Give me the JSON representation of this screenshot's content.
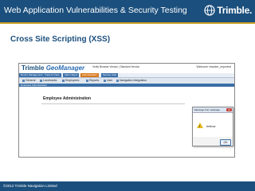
{
  "slide": {
    "header_title": "Web Application Vulnerabilities & Security Testing",
    "logo_text": "Trimble.",
    "title": "Cross Site Scripting (XSS)",
    "footer": "©2012 Trimble Navigation Limited",
    "colors": {
      "header": "#1b4f7d",
      "accent": "#c9a227",
      "title": "#1b4f7d"
    }
  },
  "app": {
    "logo_prefix": "Trimble",
    "logo_product": "GeoManager",
    "top_links": "Verify Browser Version | Standard Version",
    "welcome": "Welcome xtracker_imported",
    "tabs": [
      "Device Management",
      "Track & Trace",
      "Alarm Mgmt",
      "Administration",
      "Service Jobs"
    ],
    "active_tab": "Administration",
    "menu": [
      "General",
      "Landmarks",
      "Employees",
      "Reports",
      "User",
      "Navigation Integration"
    ],
    "breadcrumb": "Employee Administration",
    "panel_title": "Employee Administration"
  },
  "dialog": {
    "title": "Message from webpage",
    "close_label": "x",
    "message": "hellow",
    "warn_glyph": "!",
    "ok_label": "OK"
  }
}
